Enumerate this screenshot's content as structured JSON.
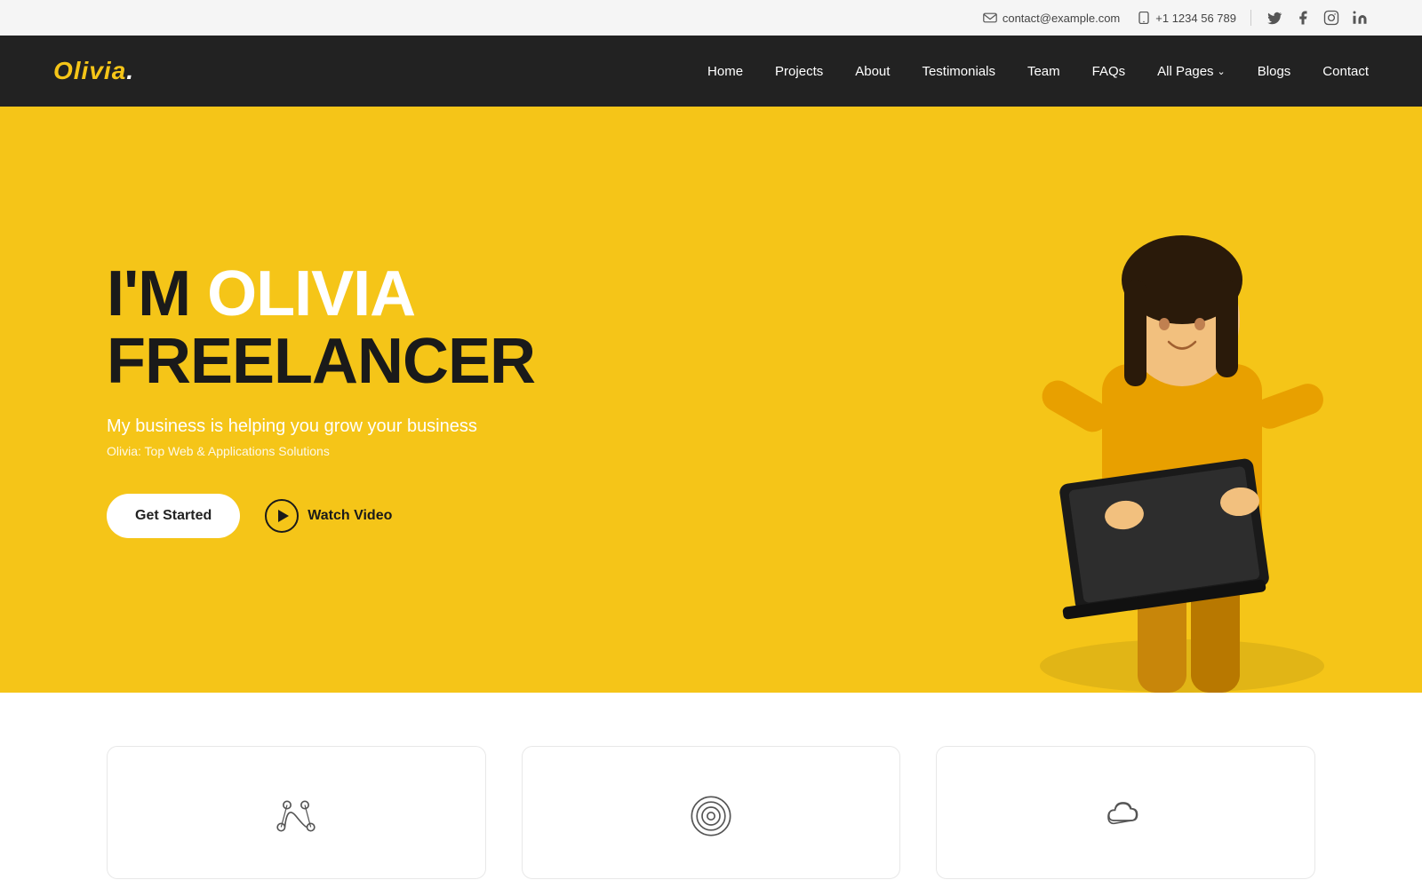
{
  "topbar": {
    "email": "contact@example.com",
    "phone": "+1 1234 56 789"
  },
  "navbar": {
    "logo": "Olivia",
    "logo_dot": ".",
    "nav_items": [
      {
        "label": "Home",
        "id": "home"
      },
      {
        "label": "Projects",
        "id": "projects"
      },
      {
        "label": "About",
        "id": "about"
      },
      {
        "label": "Testimonials",
        "id": "testimonials"
      },
      {
        "label": "Team",
        "id": "team"
      },
      {
        "label": "FAQs",
        "id": "faqs"
      },
      {
        "label": "All Pages",
        "id": "all-pages",
        "has_dropdown": true
      },
      {
        "label": "Blogs",
        "id": "blogs"
      },
      {
        "label": "Contact",
        "id": "contact"
      }
    ]
  },
  "hero": {
    "title_line1_prefix": "I'M ",
    "title_line1_highlight": "OLIVIA",
    "title_line2": "FREELANCER",
    "subtitle": "My business is helping you grow your business",
    "tagline": "Olivia: Top Web & Applications Solutions",
    "btn_get_started": "Get Started",
    "btn_watch_video": "Watch Video"
  },
  "cards": [
    {
      "id": "design",
      "icon": "bezier-icon"
    },
    {
      "id": "target",
      "icon": "target-icon"
    },
    {
      "id": "cloud",
      "icon": "cloud-icon"
    }
  ]
}
